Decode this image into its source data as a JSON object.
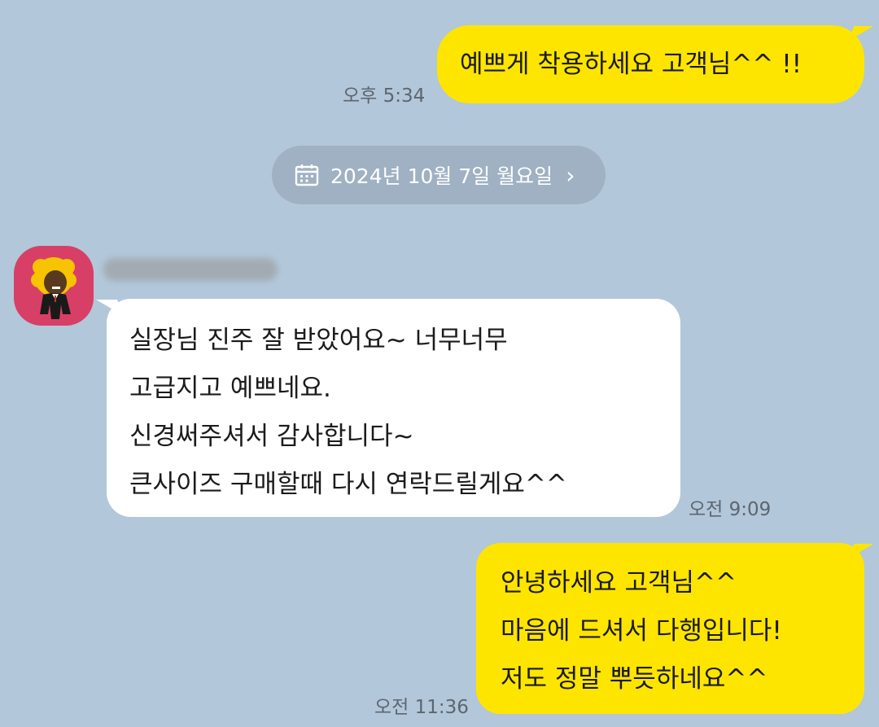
{
  "messages": [
    {
      "id": "m1",
      "side": "outgoing",
      "text": "예쁘게 착용하세요 고객님^^ !!",
      "time": "오후 5:34"
    },
    {
      "id": "m2",
      "side": "incoming",
      "text": "실장님  진주  잘  받았어요~ 너무너무\n고급지고  예쁘네요.\n신경써주셔서  감사합니다~\n큰사이즈  구매할때  다시  연락드릴게요^^",
      "time": "오전 9:09"
    },
    {
      "id": "m3",
      "side": "outgoing",
      "text": "안녕하세요 고객님^^\n마음에 드셔서 다행입니다!\n저도 정말 뿌듯하네요^^",
      "time": "오전 11:36"
    }
  ],
  "date_divider": {
    "label": "2024년 10월 7일 월요일",
    "icon": "calendar-icon",
    "chevron": "›"
  },
  "sender": {
    "avatar_icon": "character-avatar-icon",
    "name_redacted": true
  },
  "colors": {
    "background": "#b2c7da",
    "outgoing_bubble": "#fee500",
    "incoming_bubble": "#ffffff",
    "date_pill": "#9fb1c2",
    "avatar_bg": "#d83f66"
  }
}
